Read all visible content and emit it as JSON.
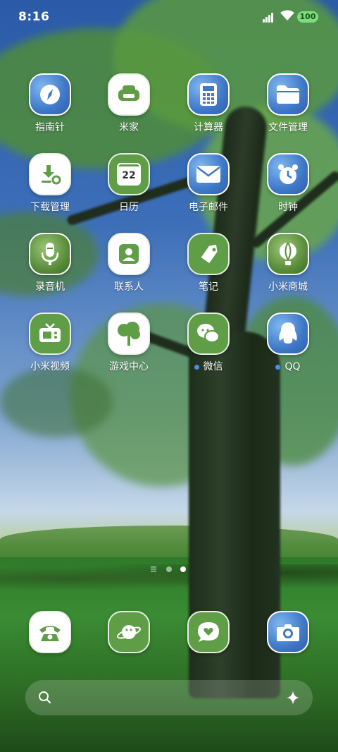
{
  "status_bar": {
    "time": "8:16",
    "battery": "100"
  },
  "apps": [
    {
      "name": "指南针",
      "icon": "compass-icon"
    },
    {
      "name": "米家",
      "icon": "sofa-icon"
    },
    {
      "name": "计算器",
      "icon": "calculator-icon"
    },
    {
      "name": "文件管理",
      "icon": "folder-icon"
    },
    {
      "name": "下载管理",
      "icon": "download-icon"
    },
    {
      "name": "日历",
      "icon": "calendar-icon",
      "badge_text": "22"
    },
    {
      "name": "电子邮件",
      "icon": "mail-icon"
    },
    {
      "name": "时钟",
      "icon": "alarm-clock-icon"
    },
    {
      "name": "录音机",
      "icon": "microphone-icon"
    },
    {
      "name": "联系人",
      "icon": "contact-card-icon"
    },
    {
      "name": "笔记",
      "icon": "note-tag-icon"
    },
    {
      "name": "小米商城",
      "icon": "balloon-icon"
    },
    {
      "name": "小米视频",
      "icon": "tv-icon"
    },
    {
      "name": "游戏中心",
      "icon": "game-tree-icon"
    },
    {
      "name": "微信",
      "icon": "wechat-icon",
      "new_dot": true
    },
    {
      "name": "QQ",
      "icon": "qq-penguin-icon",
      "new_dot": true
    }
  ],
  "dock": [
    {
      "icon": "phone-icon"
    },
    {
      "icon": "planet-browser-icon"
    },
    {
      "icon": "message-heart-icon"
    },
    {
      "icon": "camera-icon"
    }
  ],
  "pager": {
    "pages": 2,
    "current": 2
  },
  "search_bar": {
    "left_icon": "search-icon",
    "right_icon": "sparkle-icon"
  },
  "colors": {
    "accent_blue": "#4a8cf7",
    "icon_green": "#5f9d46"
  }
}
